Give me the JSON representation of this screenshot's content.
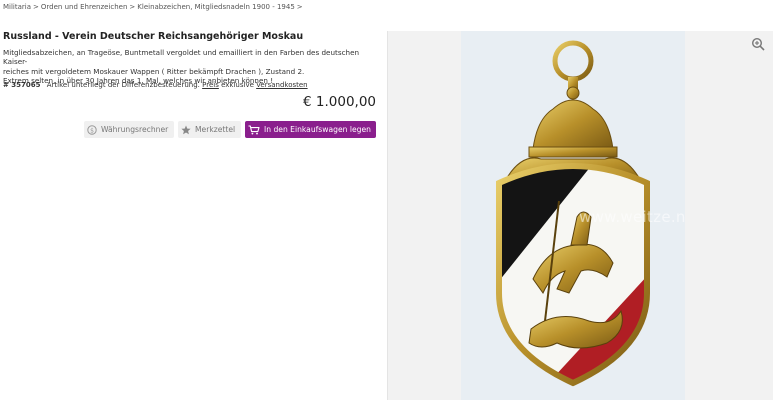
{
  "breadcrumb": [
    "Militaria",
    "Orden und Ehrenzeichen",
    "Kleinabzeichen, Mitgliedsnadeln 1900 - 1945"
  ],
  "breadcrumb_separator": ">",
  "product": {
    "title": "Russland - Verein Deutscher Reichsangehöriger Moskau",
    "description_lines": [
      "Mitgliedsabzeichen, an Trageöse, Buntmetall vergoldet und emailliert in den Farben des deutschen Kaiser-",
      "reiches mit vergoldetem Moskauer Wappen ( Ritter bekämpft Drachen ), Zustand 2.",
      "Extrem selten, in über 30 Jahren das 1. Mal, welches wir anbieten können !"
    ],
    "sku": "# 357065",
    "tax_note": "Artikel unterliegt der Differenzbesteuerung.",
    "price_link": "Preis",
    "shipping_prefix": "exklusive",
    "shipping_link": "Versandkosten",
    "price": "€ 1.000,00"
  },
  "buttons": {
    "currency": "Währungsrechner",
    "wishlist": "Merkzettel",
    "cart": "In den Einkaufswagen legen"
  },
  "image": {
    "watermark": "www.weitze.net"
  },
  "icons": {
    "currency": "currency-coin-icon",
    "wishlist": "star-icon",
    "cart": "shopping-cart-icon",
    "zoom": "zoom-in-icon"
  },
  "colors": {
    "accent": "#8a1f8d",
    "panel": "#f2f2f2",
    "button_grey": "#f0f0f0"
  }
}
